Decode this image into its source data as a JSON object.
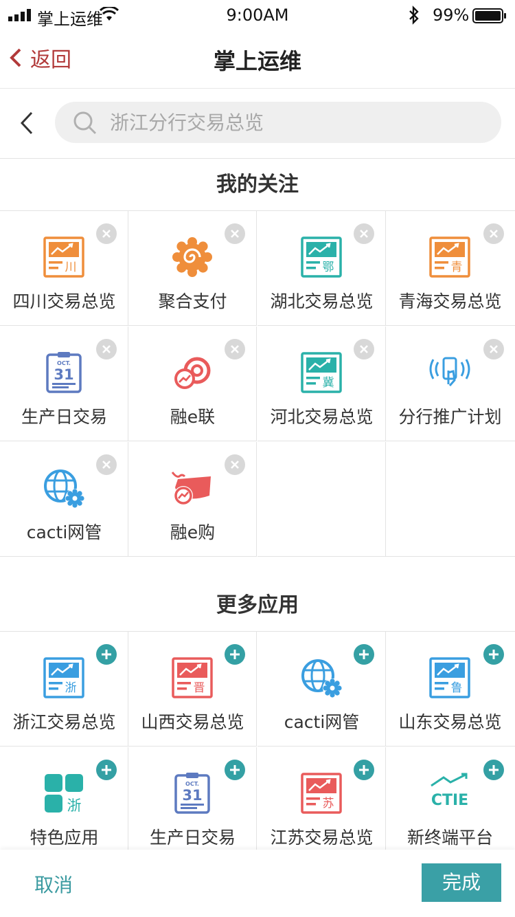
{
  "status_bar": {
    "carrier": "掌上运维",
    "time": "9:00AM",
    "battery": "99%"
  },
  "nav": {
    "back_label": "返回",
    "title": "掌上运维"
  },
  "search": {
    "placeholder": "浙江分行交易总览"
  },
  "my_follows": {
    "title": "我的关注",
    "items": [
      {
        "label": "四川交易总览",
        "icon": "chart-board-icon",
        "badge": "川",
        "color": "#ef8e3b"
      },
      {
        "label": "聚合支付",
        "icon": "sun-swirl-icon",
        "color": "#ef8e3b"
      },
      {
        "label": "湖北交易总览",
        "icon": "chart-board-icon",
        "badge": "鄂",
        "color": "#2ab1a9"
      },
      {
        "label": "青海交易总览",
        "icon": "chart-board-icon",
        "badge": "青",
        "color": "#ef8e3b"
      },
      {
        "label": "生产日交易",
        "icon": "calendar-icon",
        "cal_month": "OCT.",
        "cal_day": "31",
        "color": "#5d7ac0"
      },
      {
        "label": "融e联",
        "icon": "rong-e-lian-icon",
        "color": "#e95b5b"
      },
      {
        "label": "河北交易总览",
        "icon": "chart-board-icon",
        "badge": "冀",
        "color": "#2ab1a9"
      },
      {
        "label": "分行推广计划",
        "icon": "phone-signal-icon",
        "color": "#3a9ee0"
      },
      {
        "label": "cacti网管",
        "icon": "globe-gear-icon",
        "color": "#3a9ee0"
      },
      {
        "label": "融e购",
        "icon": "whale-chart-icon",
        "color": "#e95b5b"
      }
    ]
  },
  "more_apps": {
    "title": "更多应用",
    "items": [
      {
        "label": "浙江交易总览",
        "icon": "chart-board-icon",
        "badge": "浙",
        "color": "#3a9ee0"
      },
      {
        "label": "山西交易总览",
        "icon": "chart-board-icon",
        "badge": "晋",
        "color": "#e95b5b"
      },
      {
        "label": "cacti网管",
        "icon": "globe-gear-icon",
        "color": "#3a9ee0"
      },
      {
        "label": "山东交易总览",
        "icon": "chart-board-icon",
        "badge": "鲁",
        "color": "#3a9ee0"
      },
      {
        "label": "特色应用",
        "icon": "tiles-icon",
        "badge": "浙",
        "color": "#2ab1a9"
      },
      {
        "label": "生产日交易",
        "icon": "calendar-icon",
        "cal_month": "OCT.",
        "cal_day": "31",
        "color": "#5d7ac0"
      },
      {
        "label": "江苏交易总览",
        "icon": "chart-board-icon",
        "badge": "苏",
        "color": "#e95b5b"
      },
      {
        "label": "新终端平台",
        "icon": "ctie-icon",
        "logo_text": "CTIE",
        "color": "#2ab1a9"
      }
    ]
  },
  "footer": {
    "cancel_label": "取消",
    "done_label": "完成"
  },
  "colors": {
    "accent": "#3aa0a6",
    "back": "#b23a3a",
    "remove_badge": "#d8d8d8"
  }
}
